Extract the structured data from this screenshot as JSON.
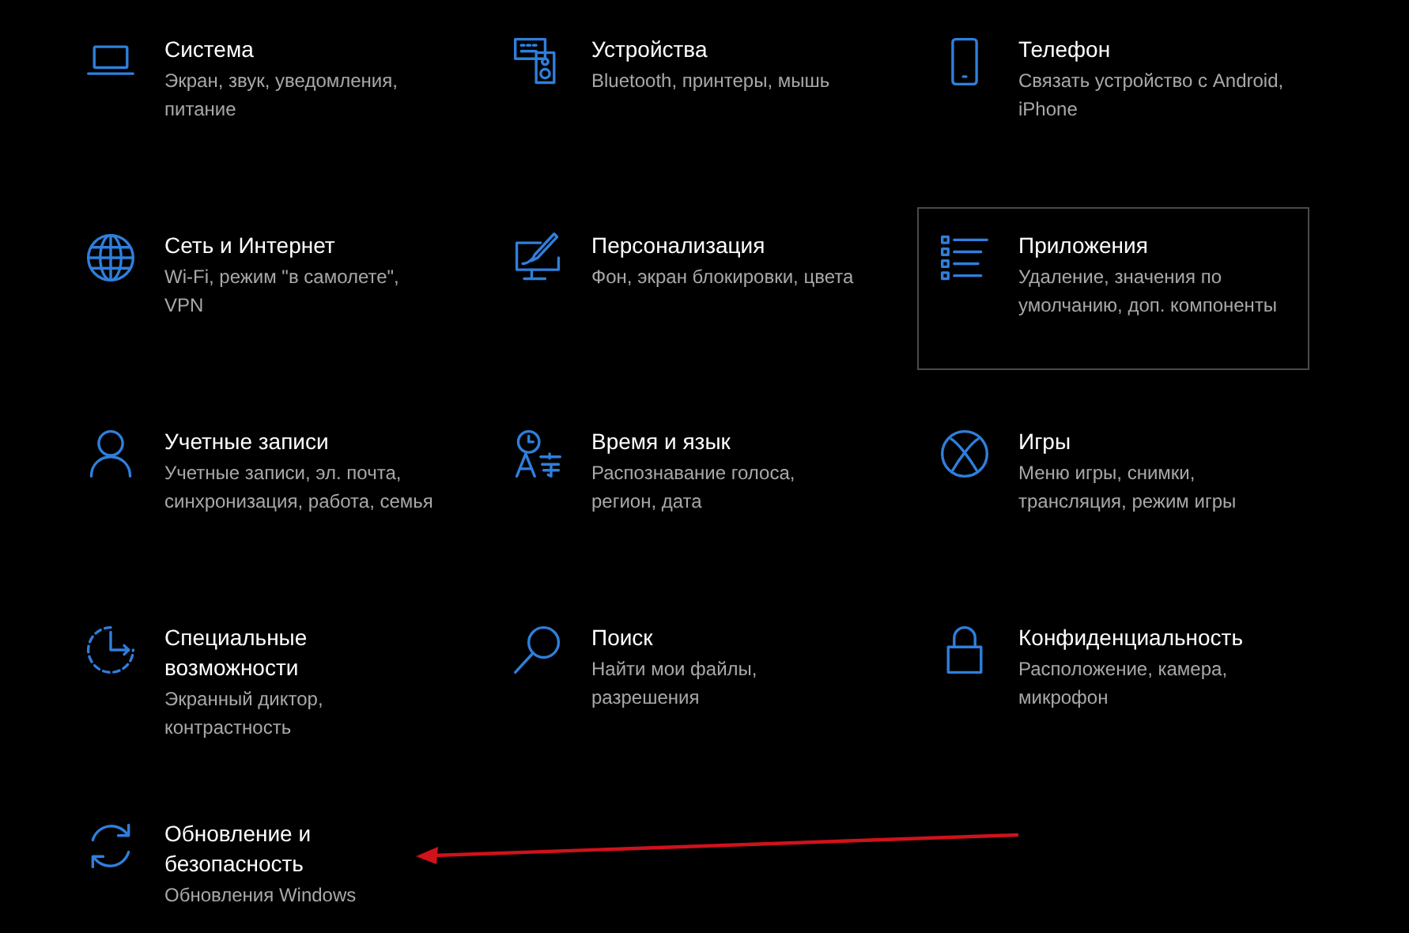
{
  "tiles": [
    {
      "kind": "laptop",
      "title_lines": [
        "Система"
      ],
      "description_lines": [
        "Экран, звук, уведомления,",
        "питание"
      ],
      "selected": false
    },
    {
      "kind": "devices",
      "title_lines": [
        "Устройства"
      ],
      "description_lines": [
        "Bluetooth, принтеры, мышь"
      ],
      "selected": false
    },
    {
      "kind": "phone",
      "title_lines": [
        "Телефон"
      ],
      "description_lines": [
        "Связать устройство с Android,",
        "iPhone"
      ],
      "selected": false
    },
    {
      "kind": "globe",
      "title_lines": [
        "Сеть и Интернет"
      ],
      "description_lines": [
        "Wi-Fi, режим \"в самолете\",",
        "VPN"
      ],
      "selected": false
    },
    {
      "kind": "personalize",
      "title_lines": [
        "Персонализация"
      ],
      "description_lines": [
        "Фон, экран блокировки, цвета"
      ],
      "selected": false
    },
    {
      "kind": "apps",
      "title_lines": [
        "Приложения"
      ],
      "description_lines": [
        "Удаление, значения по",
        "умолчанию, доп. компоненты"
      ],
      "selected": true
    },
    {
      "kind": "person",
      "title_lines": [
        "Учетные записи"
      ],
      "description_lines": [
        "Учетные записи, эл. почта,",
        "синхронизация, работа, семья"
      ],
      "selected": false
    },
    {
      "kind": "time",
      "title_lines": [
        "Время и язык"
      ],
      "description_lines": [
        "Распознавание голоса,",
        "регион, дата"
      ],
      "selected": false
    },
    {
      "kind": "games",
      "title_lines": [
        "Игры"
      ],
      "description_lines": [
        "Меню игры, снимки,",
        "трансляция, режим игры"
      ],
      "selected": false
    },
    {
      "kind": "access",
      "title_lines": [
        "Специальные",
        "возможности"
      ],
      "description_lines": [
        "Экранный диктор,",
        "контрастность"
      ],
      "selected": false
    },
    {
      "kind": "search",
      "title_lines": [
        "Поиск"
      ],
      "description_lines": [
        "Найти мои файлы,",
        "разрешения"
      ],
      "selected": false
    },
    {
      "kind": "lock",
      "title_lines": [
        "Конфиденциальность"
      ],
      "description_lines": [
        "Расположение, камера,",
        "микрофон"
      ],
      "selected": false
    },
    {
      "kind": "update",
      "title_lines": [
        "Обновление и",
        "безопасность"
      ],
      "description_lines": [
        "Обновления Windows"
      ],
      "selected": false
    }
  ]
}
